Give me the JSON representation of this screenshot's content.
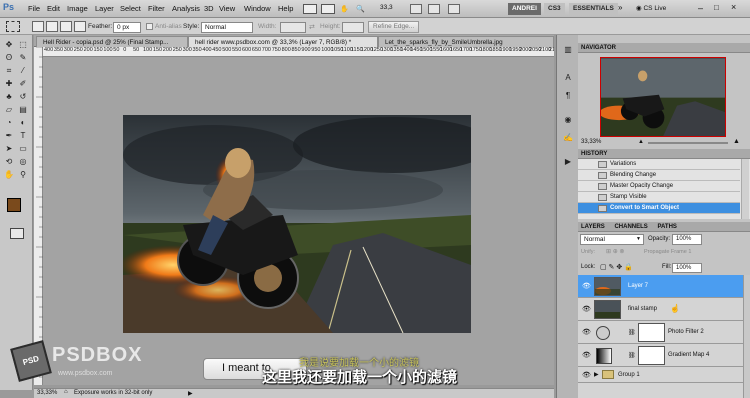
{
  "app": {
    "logo": "Ps",
    "window_buttons": [
      "–",
      "□",
      "×"
    ]
  },
  "menu": [
    "File",
    "Edit",
    "Image",
    "Layer",
    "Select",
    "Filter",
    "Analysis",
    "3D",
    "View",
    "Window",
    "Help"
  ],
  "menubar": {
    "zoom": "33,3",
    "workspaces": [
      "ANDREI",
      "CS3",
      "ESSENTIALS"
    ],
    "more": "»",
    "cs_live": "CS Live"
  },
  "options": {
    "feather_label": "Feather:",
    "feather_value": "0 px",
    "antialias_label": "Anti-alias",
    "style_label": "Style:",
    "style_value": "Normal",
    "width_label": "Width:",
    "height_label": "Height:",
    "refine_edge": "Refine Edge..."
  },
  "tabs": [
    {
      "label": "Hell Rider - copia.psd @ 25% (Final Stamp..."
    },
    {
      "label": "hell rider www.psdbox.com @ 33,3% (Layer 7, RGB/8) *",
      "active": true
    },
    {
      "label": "Let_the_sparks_fly_by_SmileUmbrella.jpg"
    }
  ],
  "ruler": [
    "400",
    "350",
    "300",
    "250",
    "200",
    "150",
    "100",
    "50",
    "0",
    "50",
    "100",
    "150",
    "200",
    "250",
    "300",
    "350",
    "400",
    "450",
    "500",
    "550",
    "600",
    "650",
    "700",
    "750",
    "800",
    "850",
    "900",
    "950",
    "1000",
    "1050",
    "1100",
    "1150",
    "1200",
    "1250",
    "1300",
    "1350",
    "1400",
    "1450",
    "1500",
    "1550",
    "1600",
    "1650",
    "1700",
    "1750",
    "1800",
    "1850",
    "1900",
    "1950",
    "2000",
    "2050",
    "2100",
    "2150",
    "2200"
  ],
  "status": {
    "zoom": "33,33%",
    "info": "Exposure works in 32-bit only"
  },
  "navigator": {
    "title": "NAVIGATOR",
    "zoom": "33,33%"
  },
  "history": {
    "title": "HISTORY",
    "items": [
      "Variations",
      "Blending Change",
      "Master Opacity Change",
      "Stamp Visible",
      "Convert to Smart Object"
    ],
    "selected": 4
  },
  "layers_panel": {
    "tabs": [
      "LAYERS",
      "CHANNELS",
      "PATHS"
    ],
    "blend_mode": "Normal",
    "opacity_label": "Opacity:",
    "opacity": "100%",
    "unify_label": "Unify:",
    "propagate": "Propagate Frame 1",
    "lock_label": "Lock:",
    "fill_label": "Fill:",
    "fill": "100%",
    "layers": [
      {
        "name": "Layer 7",
        "selected": true
      },
      {
        "name": "final stamp"
      },
      {
        "name": "Photo Filter 2"
      },
      {
        "name": "Gradient Map 4"
      },
      {
        "name": "Group 1"
      }
    ]
  },
  "overlay": {
    "button_text": "I meant to",
    "subtitle_cn": "这里我还要加载一个小的滤镜",
    "subtitle_cn_small": "我是说要加载一个小的滤镜",
    "logo_text": "PSDBOX",
    "logo_badge": "PSD",
    "logo_url": "www.psdbox.com"
  },
  "colors": {
    "accent": "#3d8fe0",
    "selection": "#4b9df0",
    "foreground_swatch": "#7a4a1c"
  }
}
